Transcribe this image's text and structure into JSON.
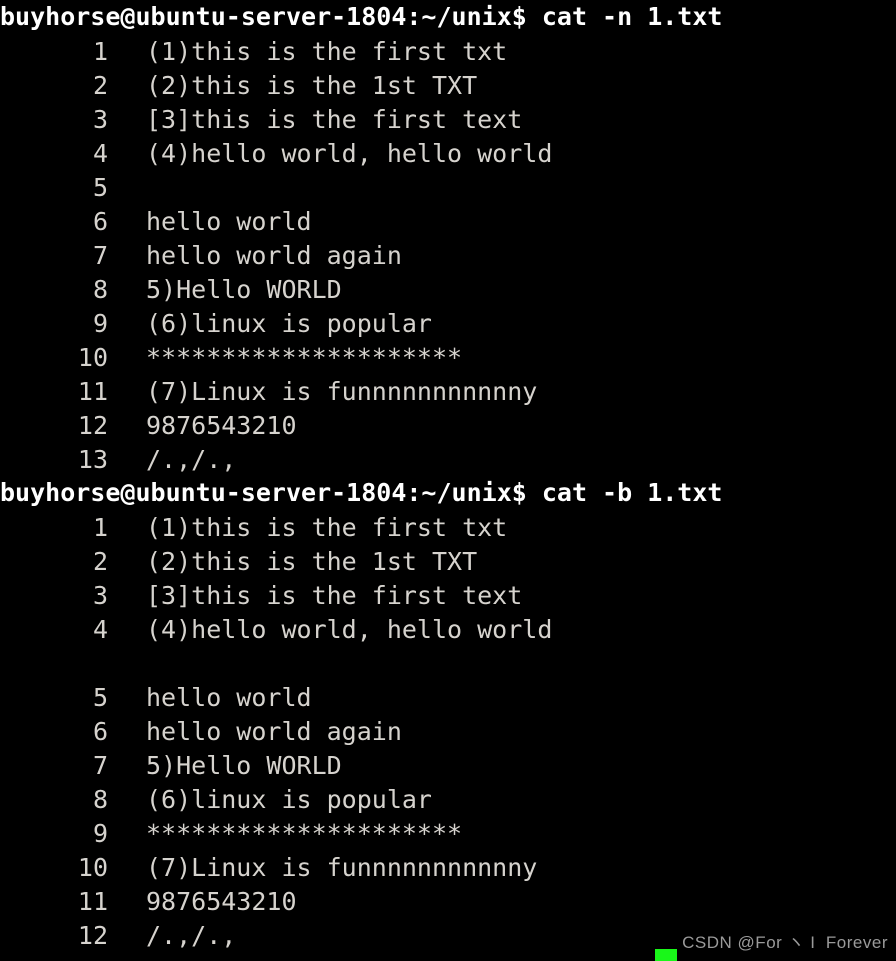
{
  "terminal": {
    "background_color": "#000000",
    "foreground_color": "#d6d3ce",
    "prompt_color": "#ffffff",
    "cursor_color": "#19f719",
    "blocks": [
      {
        "prompt": "buyhorse@ubuntu-server-1804:~/unix$ cat -n 1.txt",
        "command": "cat -n 1.txt",
        "user_host": "buyhorse@ubuntu-server-1804",
        "cwd": "~/unix",
        "lines": [
          {
            "number": "1",
            "text": "(1)this is the first txt"
          },
          {
            "number": "2",
            "text": "(2)this is the 1st TXT"
          },
          {
            "number": "3",
            "text": "[3]this is the first text"
          },
          {
            "number": "4",
            "text": "(4)hello world, hello world"
          },
          {
            "number": "5",
            "text": ""
          },
          {
            "number": "6",
            "text": "hello world"
          },
          {
            "number": "7",
            "text": "hello world again"
          },
          {
            "number": "8",
            "text": "5)Hello WORLD"
          },
          {
            "number": "9",
            "text": "(6)linux is popular"
          },
          {
            "number": "10",
            "text": "*********************"
          },
          {
            "number": "11",
            "text": "(7)Linux is funnnnnnnnnnny"
          },
          {
            "number": "12",
            "text": "9876543210"
          },
          {
            "number": "13",
            "text": "/.,/.,"
          }
        ]
      },
      {
        "prompt": "buyhorse@ubuntu-server-1804:~/unix$ cat -b 1.txt",
        "command": "cat -b 1.txt",
        "user_host": "buyhorse@ubuntu-server-1804",
        "cwd": "~/unix",
        "lines": [
          {
            "number": "1",
            "text": "(1)this is the first txt"
          },
          {
            "number": "2",
            "text": "(2)this is the 1st TXT"
          },
          {
            "number": "3",
            "text": "[3]this is the first text"
          },
          {
            "number": "4",
            "text": "(4)hello world, hello world"
          },
          {
            "number": "",
            "text": ""
          },
          {
            "number": "5",
            "text": "hello world"
          },
          {
            "number": "6",
            "text": "hello world again"
          },
          {
            "number": "7",
            "text": "5)Hello WORLD"
          },
          {
            "number": "8",
            "text": "(6)linux is popular"
          },
          {
            "number": "9",
            "text": "*********************"
          },
          {
            "number": "10",
            "text": "(7)Linux is funnnnnnnnnnny"
          },
          {
            "number": "11",
            "text": "9876543210"
          },
          {
            "number": "12",
            "text": "/.,/.,"
          }
        ]
      }
    ]
  },
  "watermark": {
    "text": "CSDN @For ヽ I  Forever"
  }
}
